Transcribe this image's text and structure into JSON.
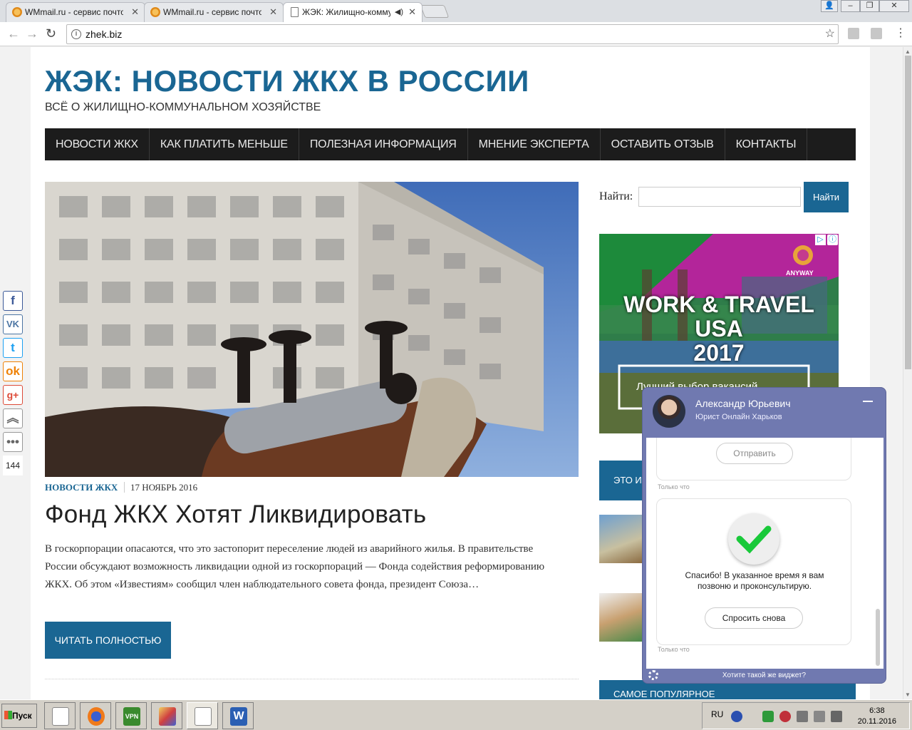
{
  "browser": {
    "tabs": [
      {
        "label": "WMmail.ru - сервис почтов",
        "active": false
      },
      {
        "label": "WMmail.ru - сервис почтов",
        "active": false
      },
      {
        "label": "ЖЭК: Жилищно-комму",
        "active": true
      }
    ],
    "url": "zhek.biz"
  },
  "site": {
    "title": "ЖЭК: НОВОСТИ ЖКХ В РОССИИ",
    "description": "ВСЁ О ЖИЛИЩНО-КОММУНАЛЬНОМ ХОЗЯЙСТВЕ",
    "nav": [
      "НОВОСТИ ЖКХ",
      "КАК ПЛАТИТЬ МЕНЬШЕ",
      "ПОЛЕЗНАЯ ИНФОРМАЦИЯ",
      "МНЕНИЕ ЭКСПЕРТА",
      "ОСТАВИТЬ ОТЗЫВ",
      "КОНТАКТЫ"
    ]
  },
  "post": {
    "category": "НОВОСТИ ЖКХ",
    "date": "17 НОЯБРЬ 2016",
    "title": "Фонд ЖКХ Хотят Ликвидировать",
    "excerpt": "В госкорпорации опасаются, что это застопорит переселение людей из аварийного жилья. В правительстве России обсуждают возможность ликвидации одной из госкорпораций — Фонда содействия реформированию ЖКХ. Об этом «Известиям» сообщил член наблюдательного совета фонда, президент Союза…",
    "read_more": "ЧИТАТЬ ПОЛНОСТЬЮ"
  },
  "sidebar": {
    "search_label": "Найти:",
    "search_button": "Найти",
    "ad_headline_1": "WORK & TRAVEL USA",
    "ad_headline_2": "2017",
    "ad_brand": "ANYWAY",
    "ad_banner_text": "Лучший выбор вакансий",
    "block_label": "ЭТО И",
    "popular_label": "САМОЕ ПОПУЛЯРНОЕ"
  },
  "share": {
    "icons": [
      "facebook-icon",
      "vk-icon",
      "twitter-icon",
      "odnoklassniki-icon",
      "google-plus-icon",
      "scroll-up-icon",
      "more-icon"
    ],
    "count": "144"
  },
  "chat": {
    "agent_name": "Александр Юрьевич",
    "agent_subtitle": "Юрист Онлайн Харьков",
    "send_button": "Отправить",
    "timestamp": "Только что",
    "thanks_text": "Спасибо! В указанное время я вам позвоню и проконсультирую.",
    "ask_again": "Спросить снова",
    "footer": "Хотите такой же виджет?"
  },
  "taskbar": {
    "start": "Пуск",
    "lang": "RU",
    "time": "6:38",
    "date": "20.11.2016"
  }
}
